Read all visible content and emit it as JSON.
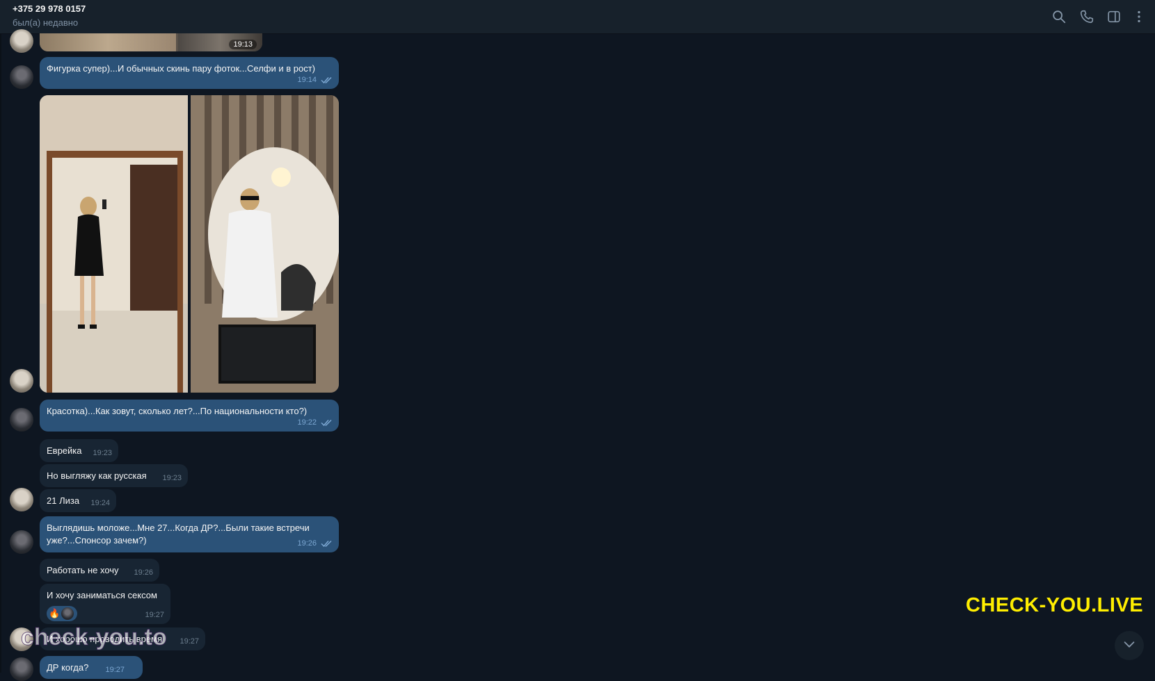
{
  "header": {
    "contact_name": "+375 29 978 0157",
    "contact_status": "был(а) недавно",
    "icons": [
      "search-icon",
      "phone-icon",
      "sidebar-toggle-icon",
      "more-vertical-icon"
    ]
  },
  "messages": {
    "photo_prev_time": "19:13",
    "m1": {
      "text": "Фигурка супер)...И обычных скинь пару фоток...Селфи и в рост)",
      "time": "19:14"
    },
    "m2": {
      "text": "Красотка)...Как зовут, сколько лет?...По национальности кто?)",
      "time": "19:22"
    },
    "m3": {
      "text": "Еврейка",
      "time": "19:23"
    },
    "m4": {
      "text": "Но выгляжу как русская",
      "time": "19:23"
    },
    "m5": {
      "text": "21 Лиза",
      "time": "19:24"
    },
    "m6": {
      "text": "Выглядишь моложе...Мне 27...Когда ДР?...Были такие встречи уже?...Спонсор зачем?)",
      "time": "19:26"
    },
    "m7": {
      "text": "Работать не хочу",
      "time": "19:26"
    },
    "m8": {
      "text": "И хочу заниматься сексом",
      "time": "19:27",
      "reaction": "🔥"
    },
    "m9": {
      "text": "И хорошо проводить время",
      "time": "19:27"
    },
    "m10": {
      "text": "ДР когда?",
      "time": "19:27"
    }
  },
  "watermarks": {
    "right": "CHECK-YOU.LIVE",
    "left": "check-you.to"
  },
  "colors": {
    "background": "#0e1621",
    "header": "#17212b",
    "outgoing": "#2b5278",
    "incoming": "#182533",
    "watermark": "#ffee00"
  }
}
